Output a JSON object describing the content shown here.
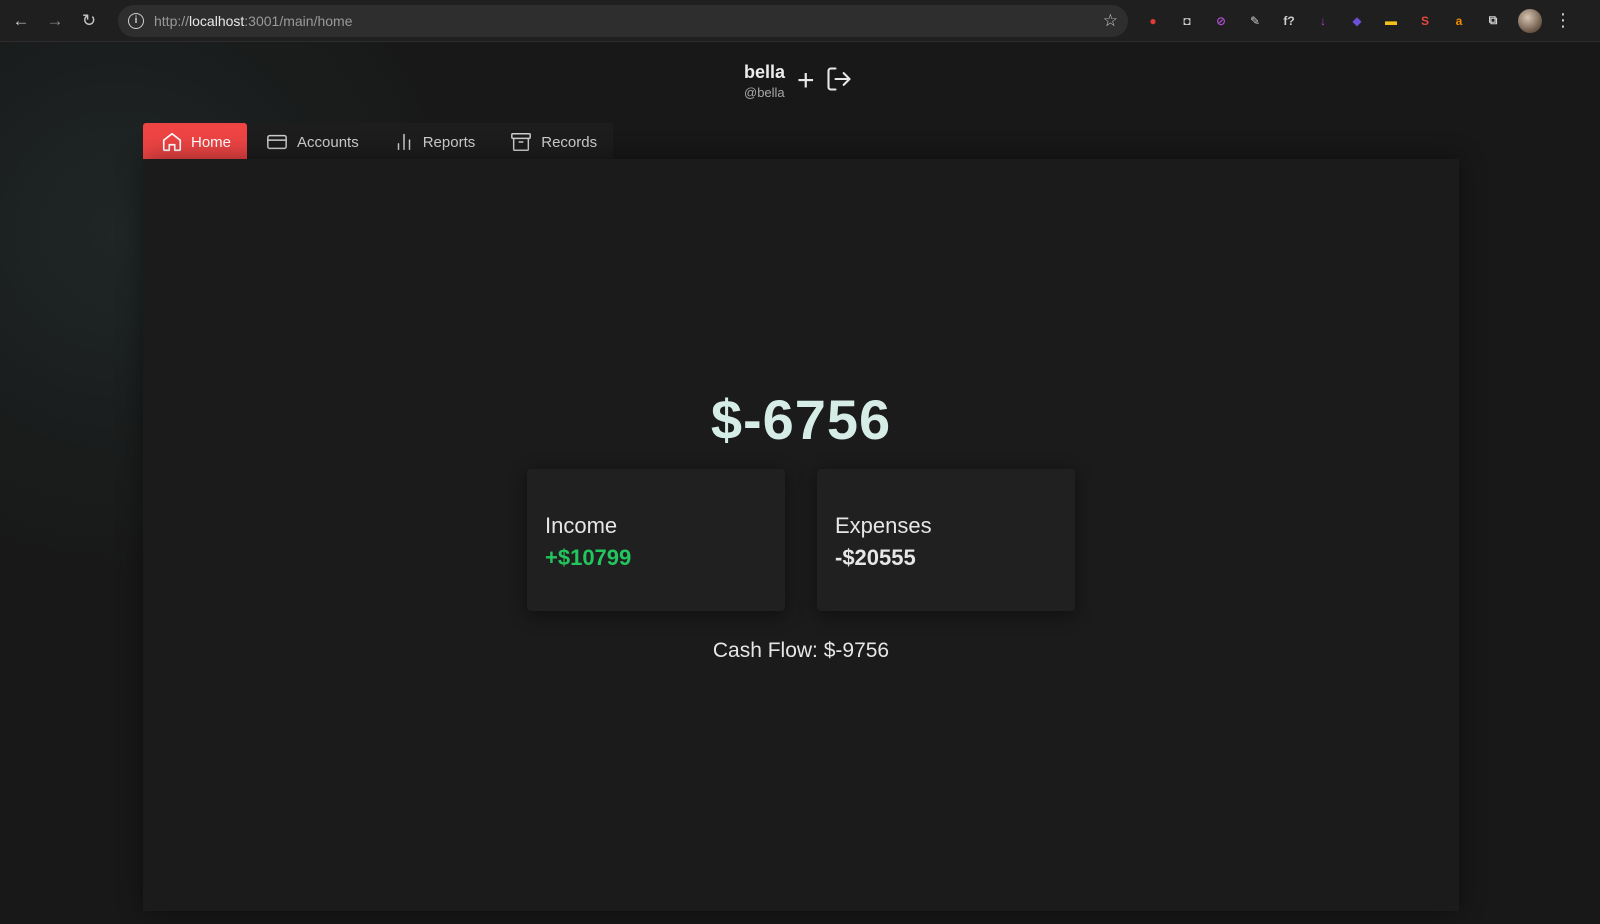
{
  "browser": {
    "url_proto": "http://",
    "url_host": "localhost",
    "url_path": ":3001/main/home",
    "extensions": [
      {
        "icon": "red-shield-icon",
        "color": "#e53935",
        "glyph": "●"
      },
      {
        "icon": "camera-icon",
        "color": "#cfcfcf",
        "glyph": "◘"
      },
      {
        "icon": "purple-compass-icon",
        "color": "#b04fd1",
        "glyph": "⊘"
      },
      {
        "icon": "pen-icon",
        "color": "#cfcfcf",
        "glyph": "✎"
      },
      {
        "icon": "font-icon",
        "color": "#cfcfcf",
        "glyph": "f?"
      },
      {
        "icon": "download-icon",
        "color": "#b23ad8",
        "glyph": "↓"
      },
      {
        "icon": "shapes-icon",
        "color": "#6b4fd8",
        "glyph": "◆"
      },
      {
        "icon": "note-icon",
        "color": "#f2c21b",
        "glyph": "▬"
      },
      {
        "icon": "s-icon",
        "color": "#e5473c",
        "glyph": "S"
      },
      {
        "icon": "amazon-icon",
        "color": "#f08c00",
        "glyph": "a"
      },
      {
        "icon": "puzzle-icon",
        "color": "#cfcfcf",
        "glyph": "⧉"
      }
    ]
  },
  "user": {
    "name": "bella",
    "handle": "@bella"
  },
  "tabs": [
    {
      "label": "Home",
      "icon": "home-icon",
      "active": true
    },
    {
      "label": "Accounts",
      "icon": "card-icon",
      "active": false
    },
    {
      "label": "Reports",
      "icon": "bar-chart-icon",
      "active": false
    },
    {
      "label": "Records",
      "icon": "archive-icon",
      "active": false
    }
  ],
  "summary": {
    "balance": "$-6756",
    "income_label": "Income",
    "income_value": "+$10799",
    "expenses_label": "Expenses",
    "expenses_value": "-$20555",
    "cash_flow": "Cash Flow: $-9756"
  },
  "colors": {
    "accent": "#ef4444",
    "income": "#22c55e",
    "balance": "#d5ede6"
  }
}
